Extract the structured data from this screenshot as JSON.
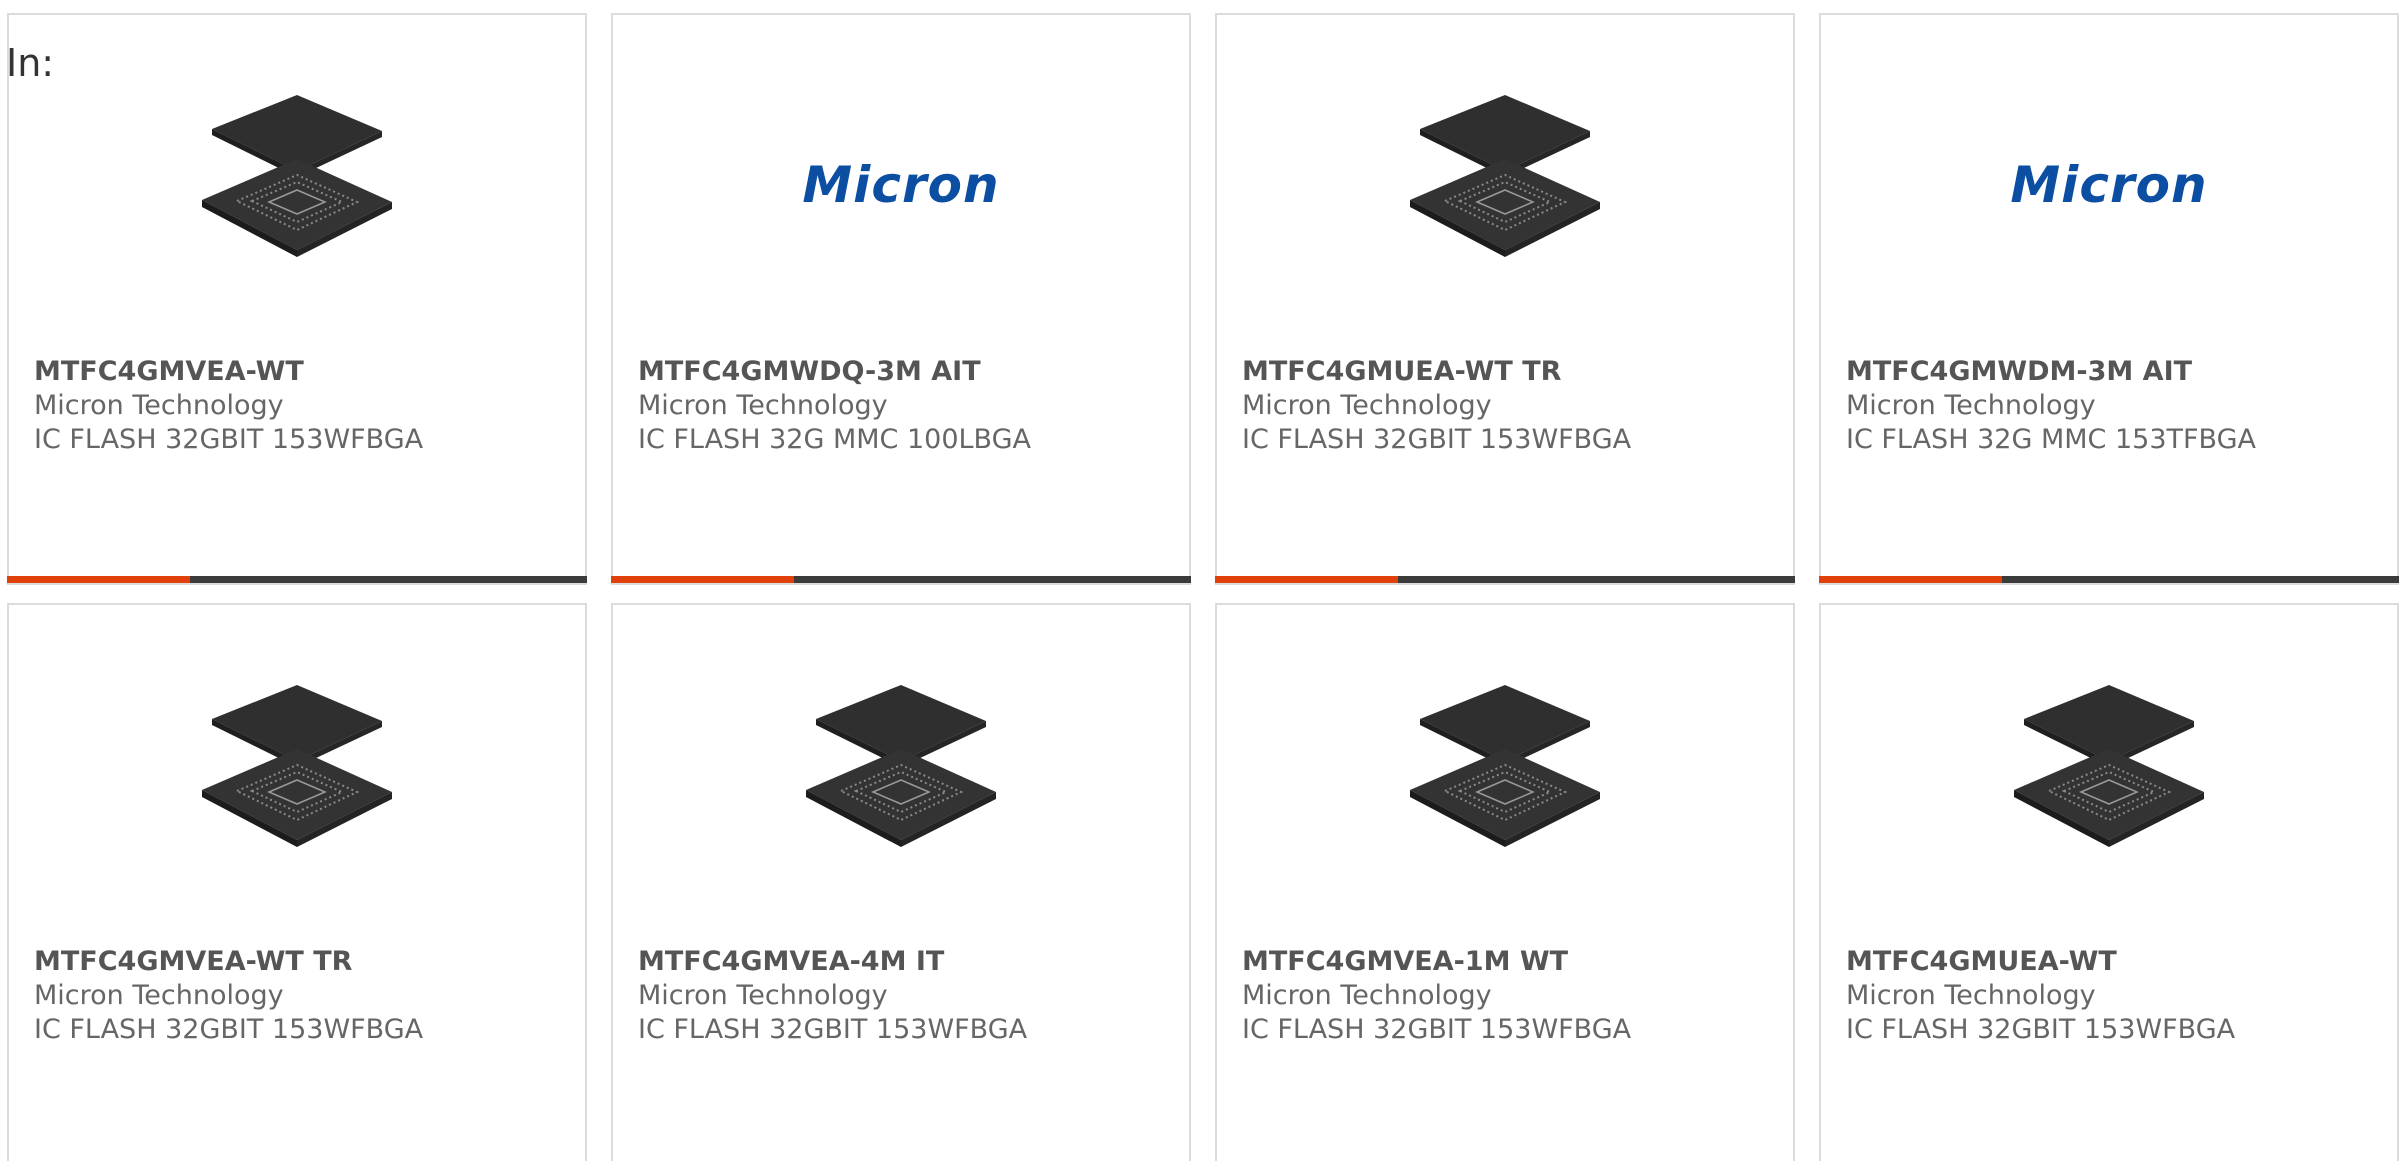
{
  "header": {
    "in_label": "In:"
  },
  "products": [
    {
      "part_number": "MTFC4GMVEA-WT",
      "manufacturer": "Micron Technology",
      "description": "IC FLASH 32GBIT 153WFBGA",
      "image": "chip"
    },
    {
      "part_number": "MTFC4GMWDQ-3M AIT",
      "manufacturer": "Micron Technology",
      "description": "IC FLASH 32G MMC 100LBGA",
      "image": "micron-logo"
    },
    {
      "part_number": "MTFC4GMUEA-WT TR",
      "manufacturer": "Micron Technology",
      "description": "IC FLASH 32GBIT 153WFBGA",
      "image": "chip"
    },
    {
      "part_number": "MTFC4GMWDM-3M AIT",
      "manufacturer": "Micron Technology",
      "description": "IC FLASH 32G MMC 153TFBGA",
      "image": "micron-logo"
    },
    {
      "part_number": "MTFC4GMVEA-WT TR",
      "manufacturer": "Micron Technology",
      "description": "IC FLASH 32GBIT 153WFBGA",
      "image": "chip"
    },
    {
      "part_number": "MTFC4GMVEA-4M IT",
      "manufacturer": "Micron Technology",
      "description": "IC FLASH 32GBIT 153WFBGA",
      "image": "chip"
    },
    {
      "part_number": "MTFC4GMVEA-1M WT",
      "manufacturer": "Micron Technology",
      "description": "IC FLASH 32GBIT 153WFBGA",
      "image": "chip"
    },
    {
      "part_number": "MTFC4GMUEA-WT",
      "manufacturer": "Micron Technology",
      "description": "IC FLASH 32GBIT 153WFBGA",
      "image": "chip"
    }
  ],
  "logo_text": "Micron",
  "colors": {
    "accent_bar": "#e0400a",
    "dark_bar": "#3b3b3b",
    "logo_blue": "#0b4ea2"
  }
}
